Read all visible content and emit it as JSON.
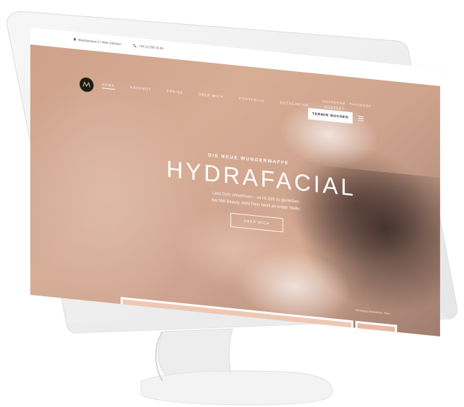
{
  "topbar": {
    "address": "Brandstrasse 6 / Wien Ettelsen",
    "phone": "+43 (1) 256 19 83",
    "pin_icon": "map-pin-icon",
    "phone_icon": "phone-icon"
  },
  "nav": {
    "items": [
      "HOME",
      "ANGEBOT",
      "PREISE",
      "ÜBER MICH",
      "PORTFOLIO",
      "GUTSCHEINE",
      "KONTAKT"
    ],
    "active": "HOME",
    "social": "INSTAGRAM · FACEBOOK",
    "book_button": "TERMIN BUCHEN",
    "menu_icon": "hamburger-menu-icon"
  },
  "hero": {
    "kicker": "DIE NEUE WUNDERWAFFE",
    "title": "HYDRAFACIAL",
    "subtitle_line1": "Lass Dich verwöhnen – es ist Zeit zu genießen.",
    "subtitle_line2": "Bei NW Beauty steht Dein Wohl an erster Stelle.",
    "cta": "ÜBER MICH",
    "credit": "NW Beauty Behandlung · Wien"
  },
  "colors": {
    "hero_tint": "#d7ad96",
    "panel": "#efc8b3",
    "logo_gold": "#c6a15a"
  }
}
